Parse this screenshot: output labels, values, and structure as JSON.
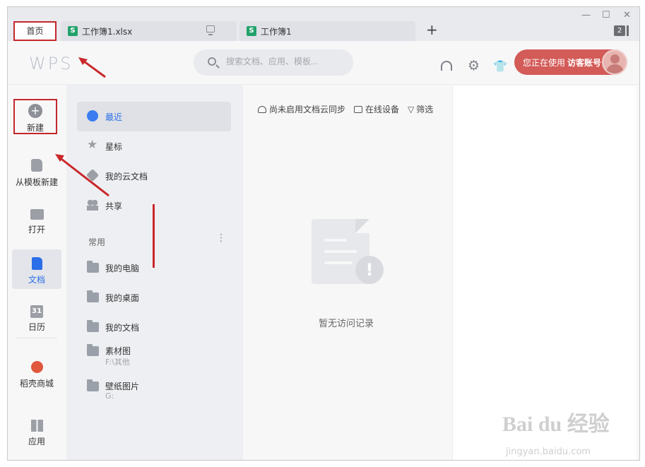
{
  "window": {
    "controls": [
      "—",
      "☐",
      "✕"
    ]
  },
  "tabs": [
    {
      "label": "首页"
    },
    {
      "label": "工作簿1.xlsx",
      "icon": "S"
    },
    {
      "label": "工作簿1",
      "icon": "S"
    }
  ],
  "tab_count": "2",
  "header": {
    "logo": "WPS",
    "search_placeholder": "搜索文档、应用、模板...",
    "account_label": "您正在使用",
    "account_name": "访客账号"
  },
  "left_nav": [
    {
      "label": "新建"
    },
    {
      "label": "从模板新建"
    },
    {
      "label": "打开"
    },
    {
      "label": "文档"
    },
    {
      "label": "日历",
      "icon_text": "31"
    },
    {
      "label": "稻壳商城"
    },
    {
      "label": "应用"
    }
  ],
  "panel2": {
    "items": [
      {
        "label": "最近"
      },
      {
        "label": "星标"
      },
      {
        "label": "我的云文档"
      },
      {
        "label": "共享"
      }
    ],
    "common_label": "常用",
    "common_items": [
      {
        "label": "我的电脑"
      },
      {
        "label": "我的桌面"
      },
      {
        "label": "我的文档"
      },
      {
        "label": "素材图",
        "sub": "F:\\其他"
      },
      {
        "label": "壁纸图片",
        "sub": "G:"
      }
    ]
  },
  "main": {
    "toolbar": [
      "尚未启用文档云同步",
      "在线设备",
      "筛选"
    ],
    "empty_text": "暂无访问记录"
  },
  "watermark": {
    "text": "Bai du 经验",
    "sub": "jingyan.baidu.com"
  },
  "colors": {
    "accent": "#2b6ee8",
    "annotation": "#c9282b",
    "account_bg": "#d35b58",
    "sheet_icon": "#23a26b"
  }
}
